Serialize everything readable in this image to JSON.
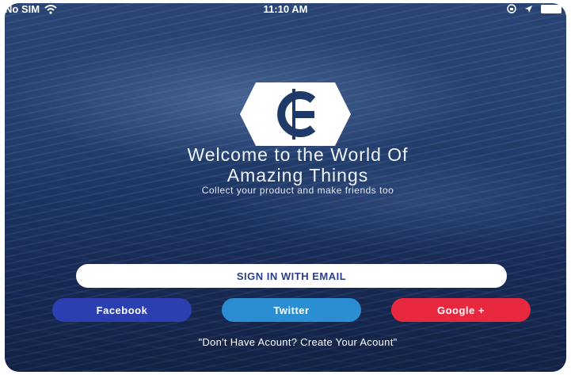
{
  "status_bar": {
    "carrier": "No SIM",
    "time": "11:10 AM",
    "icons": [
      "wifi-icon",
      "lock-rotation-icon",
      "location-arrow-icon",
      "battery-icon"
    ]
  },
  "logo": {
    "icon": "g-hexagon-logo"
  },
  "welcome": {
    "title_line1": "Welcome to the World Of",
    "title_line2": "Amazing Things",
    "subtitle": "Collect your product and make friends too"
  },
  "buttons": {
    "email": "SIGN IN WITH EMAIL",
    "facebook": "Facebook",
    "twitter": "Twitter",
    "google": "Google +"
  },
  "create_account": "\"Don't Have Acount? Create Your Acount\"",
  "colors": {
    "background": "#1f3968",
    "email_button": "#ffffff",
    "email_text": "#2b3f8a",
    "facebook": "#2b3fb0",
    "twitter": "#2b8ed3",
    "google": "#e8283e"
  }
}
